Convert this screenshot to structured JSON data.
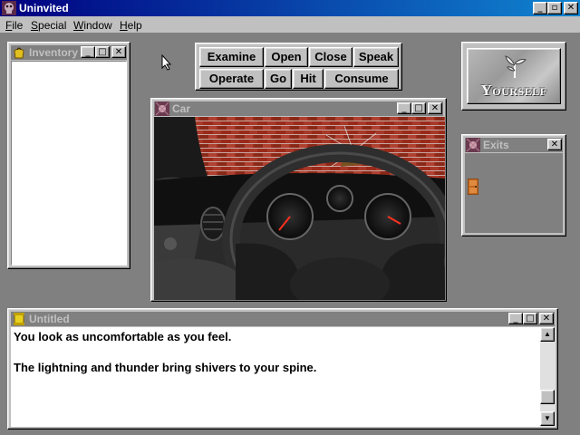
{
  "app": {
    "title": "Uninvited",
    "menu": [
      {
        "label": "File",
        "accel": "F"
      },
      {
        "label": "Special",
        "accel": "S"
      },
      {
        "label": "Window",
        "accel": "W"
      },
      {
        "label": "Help",
        "accel": "H"
      }
    ]
  },
  "inventory": {
    "title": "Inventory"
  },
  "commands": [
    "Examine",
    "Open",
    "Close",
    "Speak",
    "Operate",
    "Go",
    "Hit",
    "Consume"
  ],
  "yourself": {
    "label": "Yourself"
  },
  "car": {
    "title": "Car"
  },
  "exits": {
    "title": "Exits"
  },
  "text_window": {
    "title": "Untitled",
    "lines": [
      "You look as uncomfortable as you feel.",
      "The lightning and thunder bring shivers to your spine."
    ]
  },
  "colors": {
    "titlebar_active": "#000080",
    "titlebar_inactive": "#808080",
    "face": "#c0c0c0",
    "desktop": "#808080"
  }
}
